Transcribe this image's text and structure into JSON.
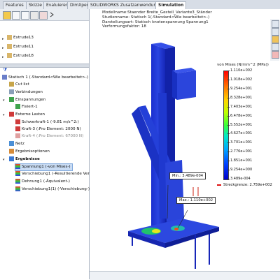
{
  "tabs": [
    "Features",
    "Skizze",
    "Evaluieren",
    "DimXpert",
    "SOLIDWORKS Zusatzanwendungen",
    "Simulation"
  ],
  "top_tree": {
    "items": [
      "Extrude13",
      "Extrude11",
      "Extrude18"
    ]
  },
  "sim_tree": {
    "study": "Statisch 1 (-Standard<Wie bearbeitet>-)",
    "items": [
      "Cut list",
      "Verbindungen",
      "Einspannungen",
      "Fixiert-1",
      "Externe Lasten",
      "Schwerkraft-1 (-9.81 m/s^2:)",
      "Kraft-3 (:Pro Element: 2000 N)",
      "Kraft-4 (:Pro Element: 67000 N)",
      "Netz",
      "Ergebnisoptionen",
      "Ergebnisse",
      "Spannung1 (-von Mises-)",
      "Verschiebung1 (-Resultierende Vers",
      "Dehnung1 (-Äquivalent-)",
      "Verschiebung1(1) (-Verschiebung-)"
    ]
  },
  "info": [
    "Modellname:Staender Breite_Gestell_Variante3_Ständer",
    "Studienname: Statisch 1(-Standard<Wie bearbeitet>-)",
    "Darstellungsart: Statisch knotenspannung Spannung1",
    "Verformungsfaktor: 18"
  ],
  "legend": {
    "title": "von Mises (N/mm^2 (MPa))",
    "values": [
      "1.110e+002",
      "1.018e+002",
      "9.254e+001",
      "8.328e+001",
      "7.403e+001",
      "6.478e+001",
      "5.552e+001",
      "4.627e+001",
      "3.701e+001",
      "2.776e+001",
      "1.851e+001",
      "9.254e+000",
      "3.489e-004"
    ],
    "yield": "Streckgrenze: 2.759e+002"
  },
  "callouts": {
    "min": "Min.: 3.489e-004",
    "max": "Max.: 1.110e+002"
  },
  "colors": {
    "accent": "#2a56c8",
    "selected": "#c9dcf4"
  }
}
